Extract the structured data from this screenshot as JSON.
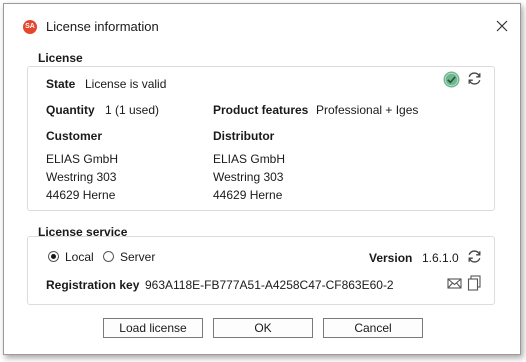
{
  "window": {
    "title": "License information",
    "app_icon_text": "SA"
  },
  "license": {
    "group_title": "License",
    "state_label": "State",
    "state_value": "License is valid",
    "quantity_label": "Quantity",
    "quantity_value": "1 (1 used)",
    "features_label": "Product features",
    "features_value": "Professional + Iges",
    "customer_label": "Customer",
    "customer_lines": [
      "ELIAS GmbH",
      "Westring 303",
      "44629 Herne"
    ],
    "distributor_label": "Distributor",
    "distributor_lines": [
      "ELIAS GmbH",
      "Westring 303",
      "44629 Herne"
    ],
    "status_color": "#6fb58f"
  },
  "service": {
    "group_title": "License service",
    "options": [
      "Local",
      "Server"
    ],
    "selected_option": "Local",
    "version_label": "Version",
    "version_value": "1.6.1.0",
    "regkey_label": "Registration key",
    "regkey_value": "963A118E-FB777A51-A4258C47-CF863E60-2"
  },
  "buttons": {
    "load": "Load license",
    "ok": "OK",
    "cancel": "Cancel"
  },
  "icons": {
    "app": "app-logo-icon",
    "close": "close-icon",
    "status": "check-circle-icon",
    "refresh": "refresh-icon",
    "mail": "mail-icon",
    "copy": "copy-icon"
  }
}
